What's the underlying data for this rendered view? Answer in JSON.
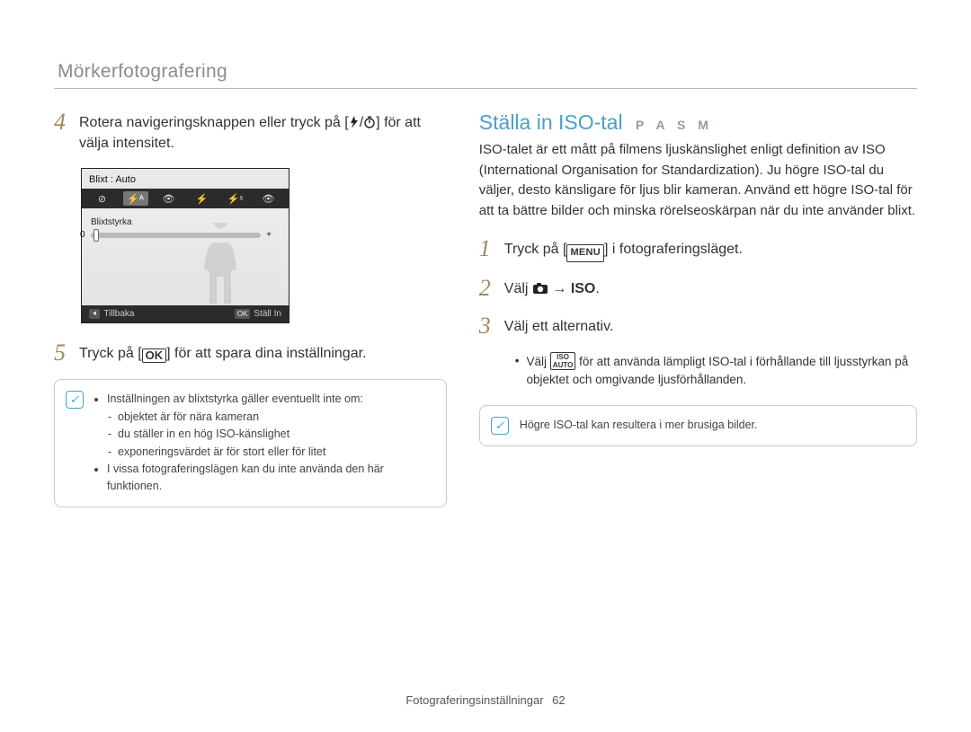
{
  "header": {
    "title": "Mörkerfotografering"
  },
  "left": {
    "step4": {
      "pre": "Rotera navigeringsknappen eller tryck på [",
      "mid": "/",
      "post": "] för att välja intensitet."
    },
    "screen": {
      "top": "Blixt : Auto",
      "body_label": "Blixtstyrka",
      "back_btn": "⯇",
      "back_label": "Tillbaka",
      "ok_btn": "OK",
      "set_label": "Ställ In"
    },
    "step5": {
      "pre": "Tryck på [",
      "post": "] för att spara dina inställningar."
    },
    "note": {
      "bullets": [
        "Inställningen av blixtstyrka gäller eventuellt inte om:",
        "I vissa fotograferingslägen kan du inte använda den här funktionen."
      ],
      "subbullets": [
        "objektet är för nära kameran",
        "du ställer in en hög ISO-känslighet",
        "exponeringsvärdet är för stort eller för litet"
      ]
    }
  },
  "right": {
    "title": "Ställa in ISO-tal",
    "modes": "P A S M",
    "intro": "ISO-talet är ett mått på filmens ljuskänslighet enligt definition av ISO (International Organisation for Standardization). Ju högre ISO-tal du väljer, desto känsligare för ljus blir kameran. Använd ett högre ISO-tal för att ta bättre bilder och minska rörelseoskärpan när du inte använder blixt.",
    "step1": {
      "pre": "Tryck på [",
      "post": "] i fotograferingsläget."
    },
    "step2": {
      "pre": "Välj ",
      "arrow": " → ",
      "iso": "ISO",
      "post": "."
    },
    "step3": {
      "text": "Välj ett alternativ."
    },
    "sub": {
      "pre": "Välj ",
      "iso_auto": "ISO\nAUTO",
      "post": " för att använda lämpligt ISO-tal i förhållande till ljusstyrkan på objektet och omgivande ljusförhållanden."
    },
    "note": {
      "text": "Högre ISO-tal kan resultera i mer brusiga bilder."
    }
  },
  "footer": {
    "section": "Fotograferingsinställningar",
    "page": "62"
  }
}
